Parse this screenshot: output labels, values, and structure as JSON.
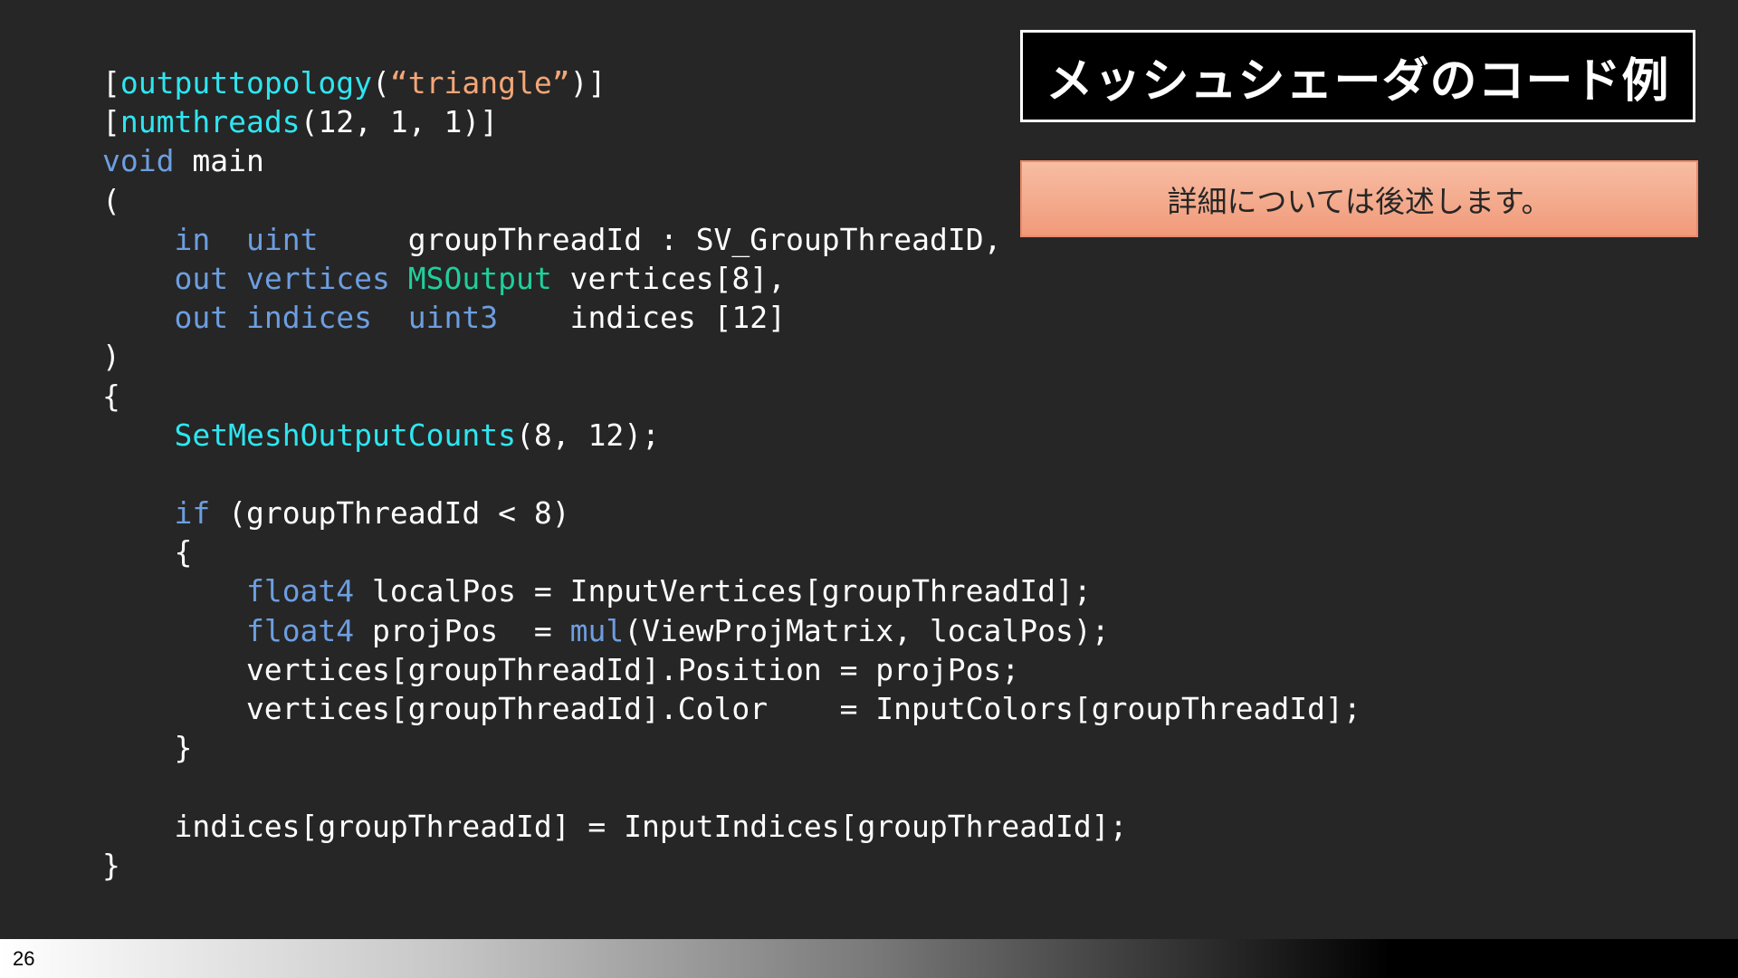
{
  "slide": {
    "title": "メッシュシェーダのコード例",
    "note": "詳細については後述します。",
    "page_number": "26"
  },
  "colors": {
    "background": "#262626",
    "plain": "#ffffff",
    "attribute": "#2ee6f0",
    "string": "#f4a677",
    "keyword": "#6d9ee0",
    "type": "#1fcf9c",
    "note_fill": "#f4a98a",
    "title_fill": "#000000"
  },
  "code": {
    "language": "HLSL",
    "lines": [
      [
        [
          "plain",
          "["
        ],
        [
          "attr",
          "outputtopology"
        ],
        [
          "plain",
          "("
        ],
        [
          "string",
          "“triangle”"
        ],
        [
          "plain",
          ")]"
        ]
      ],
      [
        [
          "plain",
          "["
        ],
        [
          "attr",
          "numthreads"
        ],
        [
          "plain",
          "(12, 1, 1)]"
        ]
      ],
      [
        [
          "keyword",
          "void"
        ],
        [
          "plain",
          " main"
        ]
      ],
      [
        [
          "plain",
          "("
        ]
      ],
      [
        [
          "plain",
          "    "
        ],
        [
          "keyword",
          "in"
        ],
        [
          "plain",
          "  "
        ],
        [
          "keyword",
          "uint"
        ],
        [
          "plain",
          "     groupThreadId : SV_GroupThreadID,"
        ]
      ],
      [
        [
          "plain",
          "    "
        ],
        [
          "keyword",
          "out"
        ],
        [
          "plain",
          " "
        ],
        [
          "keyword",
          "vertices"
        ],
        [
          "plain",
          " "
        ],
        [
          "type",
          "MSOutput"
        ],
        [
          "plain",
          " vertices[8],"
        ]
      ],
      [
        [
          "plain",
          "    "
        ],
        [
          "keyword",
          "out"
        ],
        [
          "plain",
          " "
        ],
        [
          "keyword",
          "indices"
        ],
        [
          "plain",
          "  "
        ],
        [
          "keyword",
          "uint3"
        ],
        [
          "plain",
          "    indices [12]"
        ]
      ],
      [
        [
          "plain",
          ")"
        ]
      ],
      [
        [
          "plain",
          "{"
        ]
      ],
      [
        [
          "plain",
          "    "
        ],
        [
          "func",
          "SetMeshOutputCounts"
        ],
        [
          "plain",
          "(8, 12);"
        ]
      ],
      [
        [
          "plain",
          ""
        ]
      ],
      [
        [
          "plain",
          "    "
        ],
        [
          "keyword",
          "if"
        ],
        [
          "plain",
          " (groupThreadId < 8)"
        ]
      ],
      [
        [
          "plain",
          "    {"
        ]
      ],
      [
        [
          "plain",
          "        "
        ],
        [
          "keyword",
          "float4"
        ],
        [
          "plain",
          " localPos = InputVertices[groupThreadId];"
        ]
      ],
      [
        [
          "plain",
          "        "
        ],
        [
          "keyword",
          "float4"
        ],
        [
          "plain",
          " projPos  = "
        ],
        [
          "keyword",
          "mul"
        ],
        [
          "plain",
          "(ViewProjMatrix, localPos);"
        ]
      ],
      [
        [
          "plain",
          "        vertices[groupThreadId].Position = projPos;"
        ]
      ],
      [
        [
          "plain",
          "        vertices[groupThreadId].Color    = InputColors[groupThreadId];"
        ]
      ],
      [
        [
          "plain",
          "    }"
        ]
      ],
      [
        [
          "plain",
          ""
        ]
      ],
      [
        [
          "plain",
          "    indices[groupThreadId] = InputIndices[groupThreadId];"
        ]
      ],
      [
        [
          "plain",
          "}"
        ]
      ]
    ]
  }
}
